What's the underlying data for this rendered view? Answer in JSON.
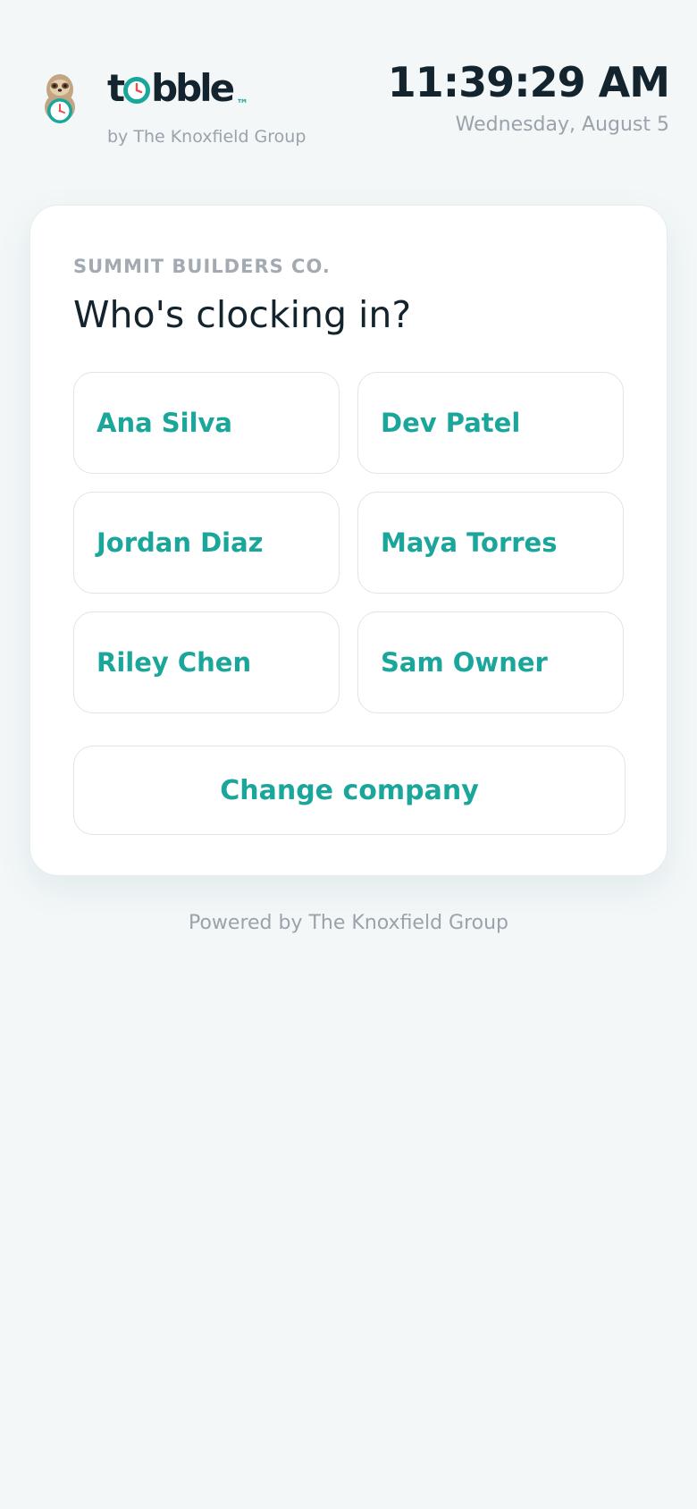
{
  "brand": {
    "name_start": "t",
    "name_end": "bble",
    "trademark": "™",
    "byline": "by The Knoxfield Group",
    "logo_icon": "sloth-clock-mascot-icon",
    "accent_color": "#1aa69b"
  },
  "clock": {
    "time": "11:39:29 AM",
    "date": "Wednesday, August 5"
  },
  "card": {
    "company": "SUMMIT BUILDERS CO.",
    "prompt": "Who's clocking in?",
    "employees": [
      {
        "name": "Ana Silva"
      },
      {
        "name": "Dev Patel"
      },
      {
        "name": "Jordan Diaz"
      },
      {
        "name": "Maya Torres"
      },
      {
        "name": "Riley Chen"
      },
      {
        "name": "Sam Owner"
      }
    ],
    "change_company_label": "Change company"
  },
  "footer": {
    "text": "Powered by The Knoxfield Group"
  }
}
